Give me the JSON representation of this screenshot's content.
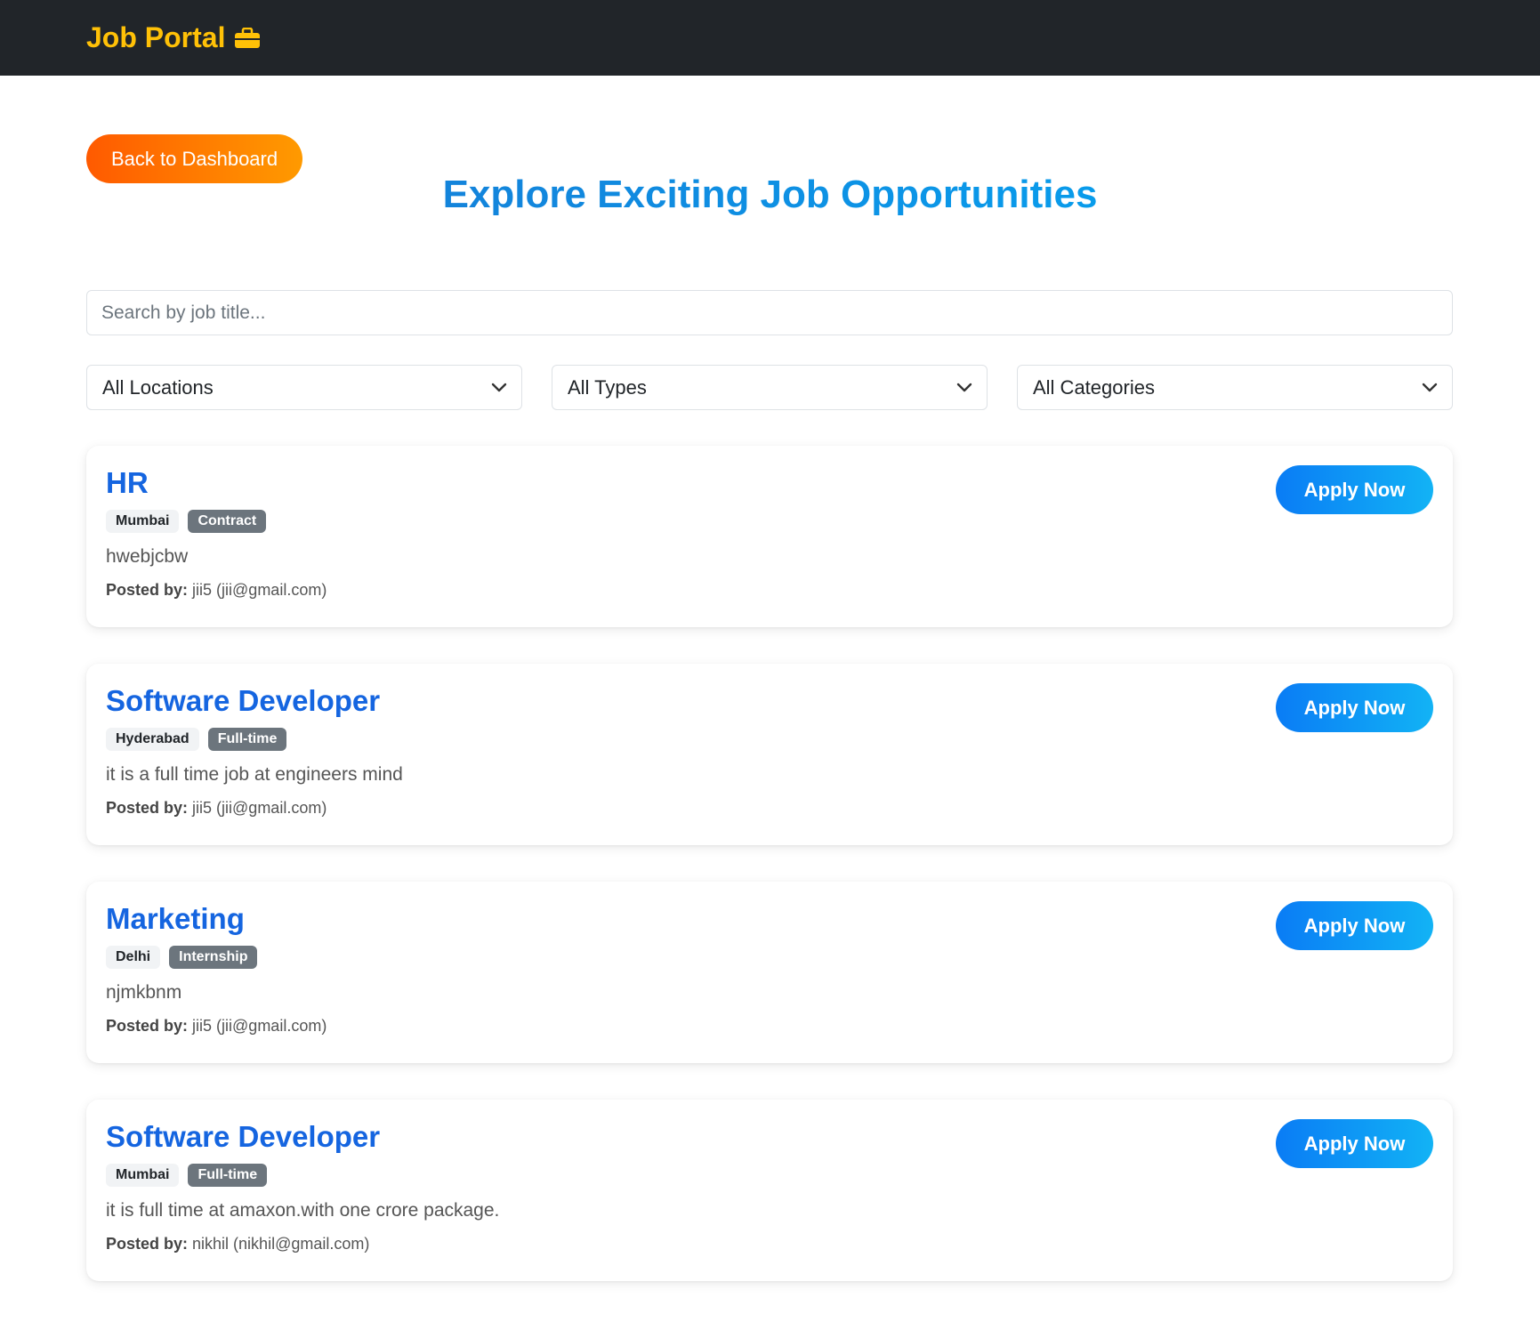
{
  "navbar": {
    "brand": "Job Portal",
    "brand_icon": "briefcase-icon",
    "brand_color": "#ffc107"
  },
  "back_button": "Back to Dashboard",
  "page_title": "Explore Exciting Job Opportunities",
  "search": {
    "placeholder": "Search by job title...",
    "value": ""
  },
  "filters": {
    "location": "All Locations",
    "type": "All Types",
    "category": "All Categories"
  },
  "jobs": [
    {
      "title": "HR",
      "location": "Mumbai",
      "type": "Contract",
      "description": "hwebjcbw",
      "posted_label": "Posted by:",
      "posted_by": "jii5 (jii@gmail.com)",
      "apply": "Apply Now"
    },
    {
      "title": "Software Developer",
      "location": "Hyderabad",
      "type": "Full-time",
      "description": "it is a full time job at engineers mind",
      "posted_label": "Posted by:",
      "posted_by": "jii5 (jii@gmail.com)",
      "apply": "Apply Now"
    },
    {
      "title": "Marketing",
      "location": "Delhi",
      "type": "Internship",
      "description": "njmkbnm",
      "posted_label": "Posted by:",
      "posted_by": "jii5 (jii@gmail.com)",
      "apply": "Apply Now"
    },
    {
      "title": "Software Developer",
      "location": "Mumbai",
      "type": "Full-time",
      "description": "it is full time at amaxon.with one crore package.",
      "posted_label": "Posted by:",
      "posted_by": "nikhil (nikhil@gmail.com)",
      "apply": "Apply Now"
    }
  ]
}
